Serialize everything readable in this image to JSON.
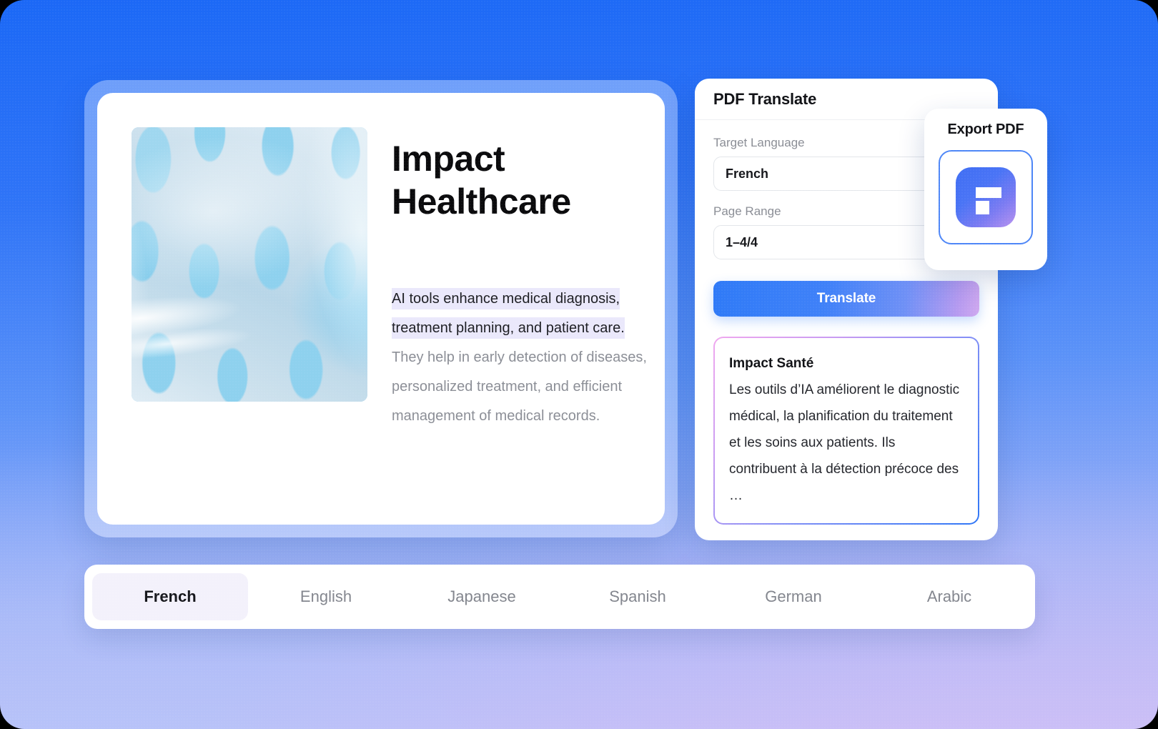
{
  "background": {
    "top_color": "#1b68f6",
    "bottom_left_color": "#b7c6fa",
    "bottom_right_color": "#cfc2f8"
  },
  "document": {
    "title": "Impact Healthcare",
    "thumbnail_alt": "abstract-blue-organic-render",
    "body": {
      "highlighted": "AI tools enhance medical diagnosis, treatment planning, and patient care.",
      "rest": " They help in early detection of diseases, personalized treatment, and efficient management of medical records.",
      "highlight_color": "#eae8fb"
    }
  },
  "panel": {
    "title": "PDF Translate",
    "target_language": {
      "label": "Target Language",
      "value": "French",
      "placeholder": "Select language"
    },
    "page_range": {
      "label": "Page Range",
      "value": "1–4/4",
      "placeholder": "e.g. 1-4"
    },
    "translate_button": "Translate",
    "translate_button_gradient": [
      "#2f7af7",
      "#cfa8ef"
    ],
    "result": {
      "title": "Impact Santé",
      "text": "Les outils d’IA améliorent le diagnostic médical, la planification du traitement et les soins aux patients. Ils contribuent à la détection précoce des …",
      "border_gradient": [
        "#f0a8ef",
        "#2f76f6"
      ]
    }
  },
  "export_card": {
    "title": "Export PDF",
    "icon_name": "pdf-file-icon",
    "icon_gradient": [
      "#3f6ef4",
      "#b892ef"
    ],
    "tile_border_color": "#4d86f7"
  },
  "language_bar": {
    "active": "French",
    "tabs": [
      {
        "label": "French"
      },
      {
        "label": "English"
      },
      {
        "label": "Japanese"
      },
      {
        "label": "Spanish"
      },
      {
        "label": "German"
      },
      {
        "label": "Arabic"
      }
    ]
  }
}
